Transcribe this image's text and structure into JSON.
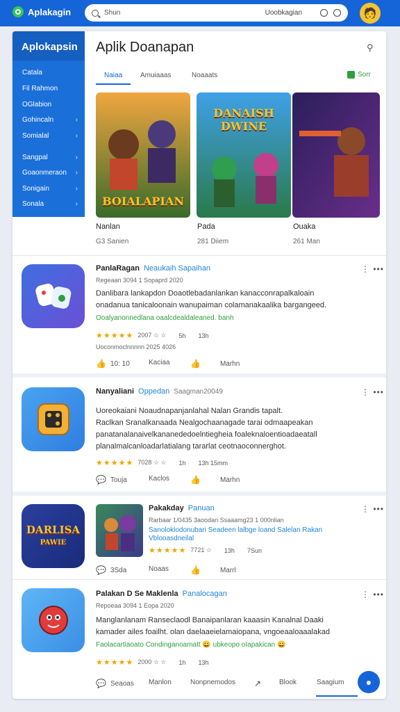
{
  "app": {
    "name": "Aplakagin"
  },
  "search": {
    "placeholder": "Shun",
    "hint": "Uoobkagian"
  },
  "sidebar": {
    "title": "Aplokapsin",
    "items": [
      {
        "label": "Catala",
        "chev": ""
      },
      {
        "label": "Fil Rahmon",
        "chev": ""
      },
      {
        "label": "OGlabion",
        "chev": ""
      },
      {
        "label": "Gohincaln",
        "chev": "›"
      },
      {
        "label": "Somialal",
        "chev": "›"
      },
      {
        "label": "Sangpal",
        "chev": "›"
      },
      {
        "label": "Goaonmeraon",
        "chev": "›"
      },
      {
        "label": "Sonigain",
        "chev": "›"
      },
      {
        "label": "Sonala",
        "chev": "›"
      }
    ]
  },
  "page": {
    "title": "Aplik Doanapan"
  },
  "tabs": [
    {
      "label": "Naiaa"
    },
    {
      "label": "Amuiaaas"
    },
    {
      "label": "Noaaats"
    }
  ],
  "tab_action": {
    "label": "Sorr"
  },
  "featured": [
    {
      "name": "Nanlan",
      "meta": "G3 Sanien",
      "art_text": "BOIALAPIAN"
    },
    {
      "name": "Pada",
      "meta": "281 Diiem",
      "art_text": "DANAISH DWINE"
    },
    {
      "name": "Ouaka",
      "meta": "261 Man",
      "art_text": ""
    }
  ],
  "list": [
    {
      "title": "PanlaRagan",
      "accent": "Neaukaih Sapaihan",
      "muted": "",
      "sub": "Regeaan 3094 1 Sopaprd 2020",
      "desc": [
        "Danlibara lankapdon Doaotlebadanlankan kanacconrapalkaloain",
        "onadanua tanicaloonain wanupaiman colamanakaalika bargangeed."
      ],
      "link": "Ooalyanonnedlana oaalcdealdaleaned. banh",
      "rating": "★★★★★",
      "rating_num": "2007 ☆ ☆",
      "count1": "5h",
      "count2": "13h",
      "under": "Uoconmoclnnnnn 2025 4026",
      "actions": [
        {
          "icon": "👍",
          "label": "10: 10"
        },
        {
          "icon": "",
          "label": "Kaciaa"
        },
        {
          "icon": "👍",
          "label": "Marhn"
        }
      ]
    },
    {
      "title": "Nanyaliani",
      "accent": "Oppedan",
      "muted": "Saagman20049",
      "sub": "",
      "desc": [
        "Uoreokaiani Noaudnapanjanlahal Nalan Grandis tapalt.",
        "Raclkan Sranalkanaada Nealgochaanagade tarai odmaapeakan",
        "panatanalanaivelkananededoelntiegheia foaleknaloentioadaeatall",
        "planalmalcanloadarlatialang tararlat ceotnaoconnerghot."
      ],
      "link": "",
      "rating": "★★★★★",
      "rating_num": "7028 ☆ ☆",
      "count1": "1h",
      "count2": "13h  15mm",
      "under": "",
      "actions": [
        {
          "icon": "💬",
          "label": "Touja"
        },
        {
          "icon": "",
          "label": "Kaclos"
        },
        {
          "icon": "👍",
          "label": "Marhn"
        }
      ]
    },
    {
      "title": "Pakakday",
      "accent": "Panuan",
      "muted": "",
      "sub": "Rarbaar 1/0435 3aoodan Ssaaamg23 1 000nlian",
      "desc_blue": [
        "Sanoloklodonubari Seadeen lalbge loand Salelan Rakan",
        "Vblooasdneilal"
      ],
      "rating": "★★★★★",
      "rating_num": "7721 ☆",
      "count1": "13h",
      "count2": "7Sun",
      "actions": [
        {
          "icon": "💬",
          "label": "3Sda"
        },
        {
          "icon": "",
          "label": "Noaas"
        },
        {
          "icon": "👍",
          "label": "Marrl"
        }
      ]
    },
    {
      "title": "Palakan D Se Maklenla",
      "accent": "Panalocagan",
      "muted": "",
      "sub": "Repoeaa 3094 1 Eopa 2020",
      "desc": [
        "Manglanlanam Ranseclaodl Banaipanlaran kaaasin Kanalnal Daaki",
        "kamader ailes foailht. olan daelaaeielamaiopana, vngoeaaloaaalakad"
      ],
      "link": "Faolacartiaoato Condinganoamatt 😀 ubkeopo oIapakican 😀",
      "rating": "★★★★★",
      "rating_num": "2000 ☆ ☆",
      "count1": "1h",
      "count2": "13h",
      "actions": [
        {
          "icon": "💬",
          "label": "Seaoas"
        },
        {
          "icon": "",
          "label": "Manlon"
        },
        {
          "icon": "",
          "label": "Nonpnemodos"
        },
        {
          "icon": "↗",
          "label": ""
        },
        {
          "icon": "",
          "label": "Blook"
        },
        {
          "icon": "",
          "label": "Saagium"
        }
      ]
    }
  ],
  "colors": {
    "primary": "#1565d8",
    "accent_green": "#2e9e3e",
    "star": "#f0a500"
  }
}
